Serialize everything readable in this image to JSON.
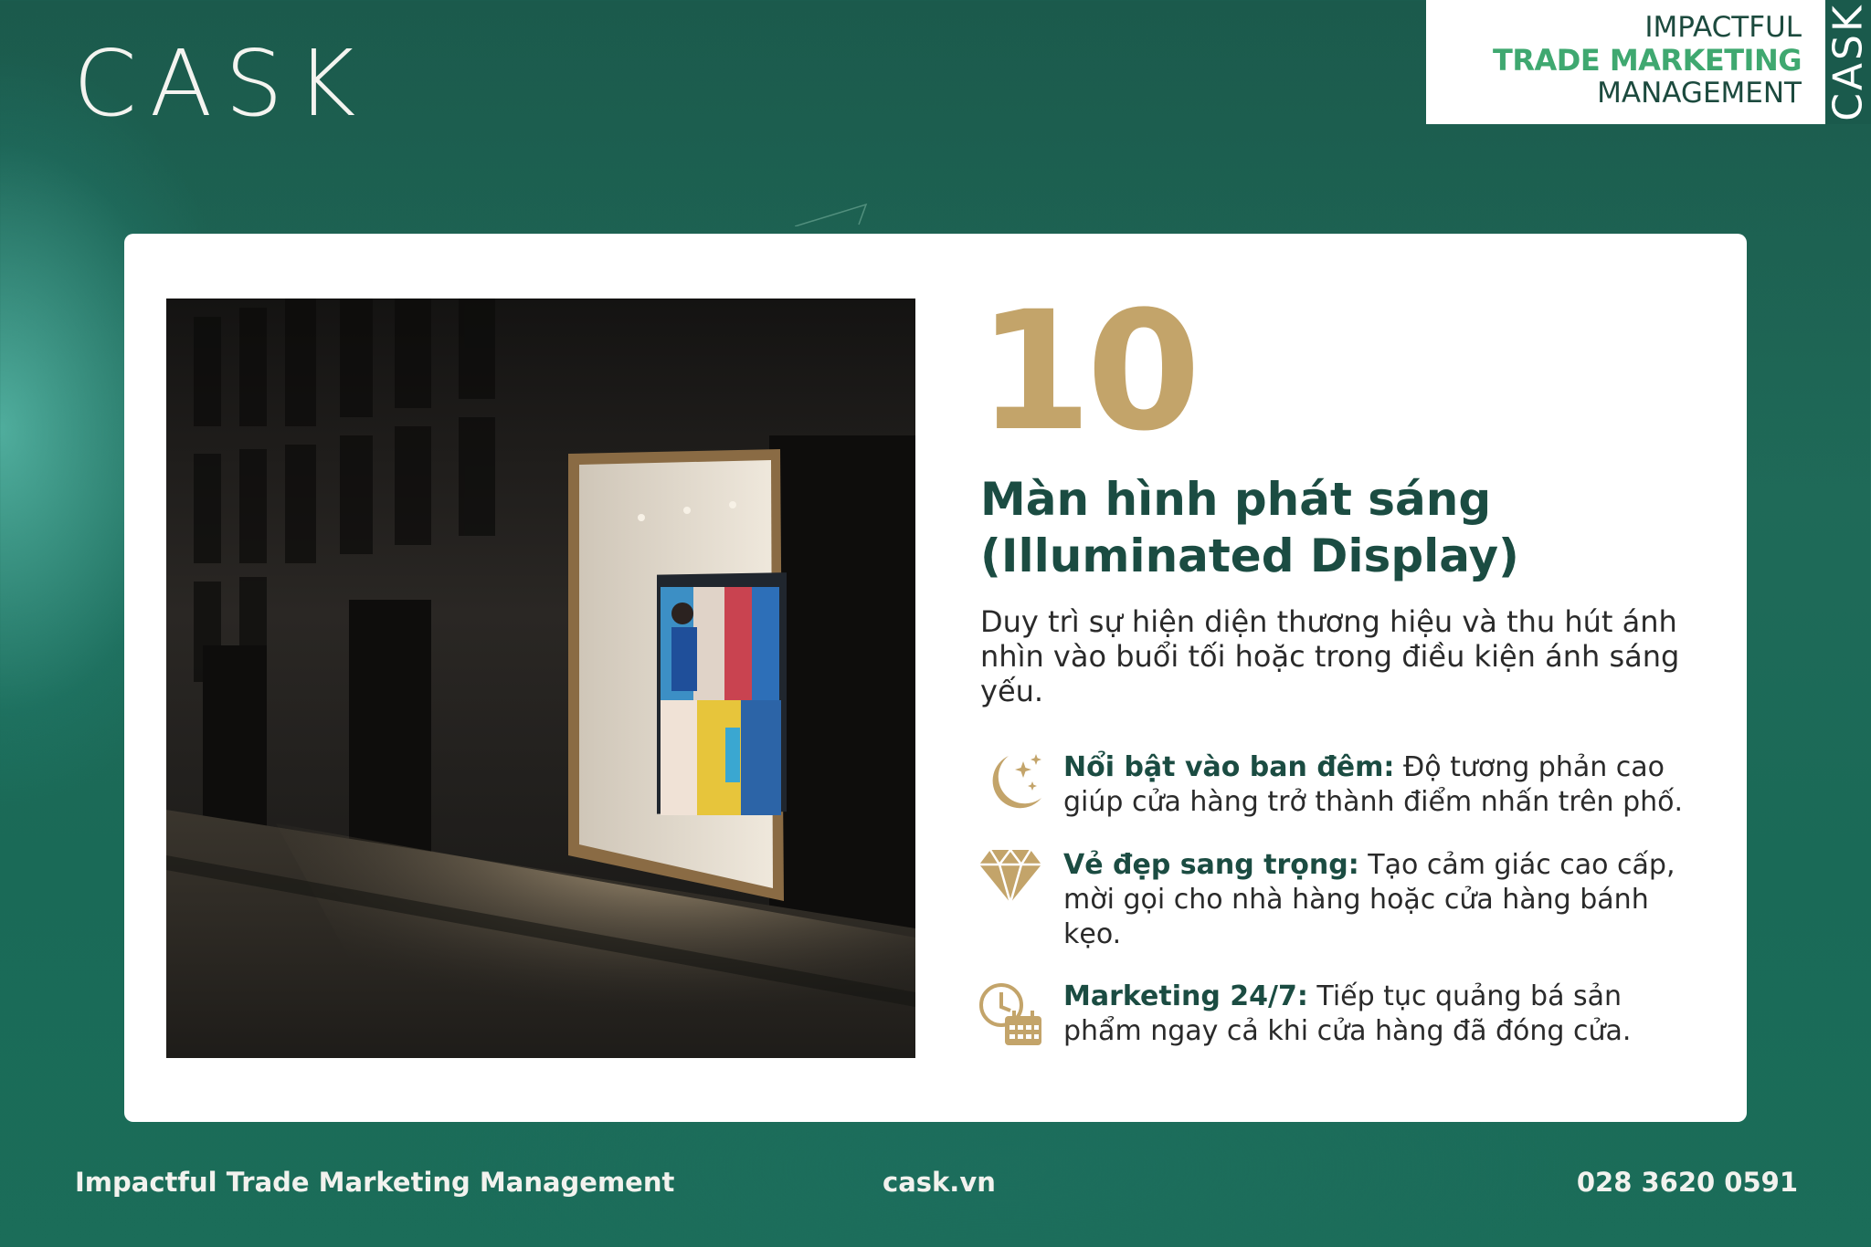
{
  "header": {
    "logo_text": "CASK",
    "badge": {
      "line1": "IMPACTFUL",
      "line2": "TRADE MARKETING",
      "line3": "MANAGEMENT",
      "side_text": "CASK"
    }
  },
  "card": {
    "number": "10",
    "title_line1": "Màn hình phát sáng",
    "title_line2": "(Illuminated Display)",
    "intro": "Duy trì sự hiện diện thương hiệu và thu hút ánh nhìn vào buổi tối hoặc trong điều kiện ánh sáng yếu.",
    "features": [
      {
        "icon": "moon-stars-icon",
        "label": "Nổi bật vào ban đêm:",
        "text": " Độ tương phản cao giúp cửa hàng trở thành điểm nhấn trên phố."
      },
      {
        "icon": "diamond-icon",
        "label": "Vẻ đẹp sang trọng:",
        "text": " Tạo cảm giác cao cấp, mời gọi cho nhà hàng hoặc cửa hàng bánh kẹo."
      },
      {
        "icon": "clock-calendar-icon",
        "label": "Marketing 24/7:",
        "text": " Tiếp tục quảng bá sản phẩm ngay cả khi cửa hàng đã đóng cửa."
      }
    ]
  },
  "footer": {
    "tagline": "Impactful Trade Marketing Management",
    "website": "cask.vn",
    "phone": "028 3620 0591"
  },
  "colors": {
    "background_green": "#1d6553",
    "accent_gold": "#c3a46a",
    "title_green": "#1b4c42",
    "badge_green": "#3fa870"
  }
}
